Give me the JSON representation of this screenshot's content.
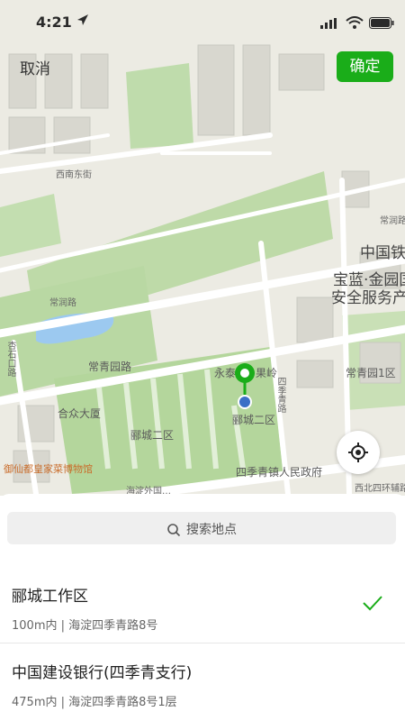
{
  "status_bar": {
    "time": "4:21"
  },
  "header": {
    "cancel_label": "取消",
    "confirm_label": "确定"
  },
  "map": {
    "labels": {
      "xinan_east": "西南东街",
      "changrun": "常润路",
      "china_railway": "中国铁",
      "baolan": "宝蓝·金园国",
      "security": "安全服务产",
      "changqing_road": "常青园路",
      "yongtai": "永泰",
      "guoling": "果岭",
      "changqing_1": "常青园1区",
      "hezhong": "合众大厦",
      "licheng_2a": "郦城二区",
      "licheng_2b": "郦城二区",
      "museum": "御仙都皇家菜博物馆",
      "gov": "四季青镇人民政府",
      "road_small_1": "常润路",
      "road_vertical_1": "杏石口路",
      "road_vertical_2": "四季青路",
      "bottom_road": "西北四环辅路",
      "bottom_left": "海淀外国…"
    },
    "accent_color": "#1aad19",
    "pin_color": "#1aad19",
    "locate_icon": "crosshair-icon"
  },
  "search": {
    "placeholder": "搜索地点"
  },
  "results": [
    {
      "title": "郦城工作区",
      "subtitle": "100m内 | 海淀四季青路8号",
      "selected": true
    },
    {
      "title": "中国建设银行(四季青支行)",
      "subtitle": "475m内 | 海淀四季青路8号1层",
      "selected": false
    }
  ]
}
